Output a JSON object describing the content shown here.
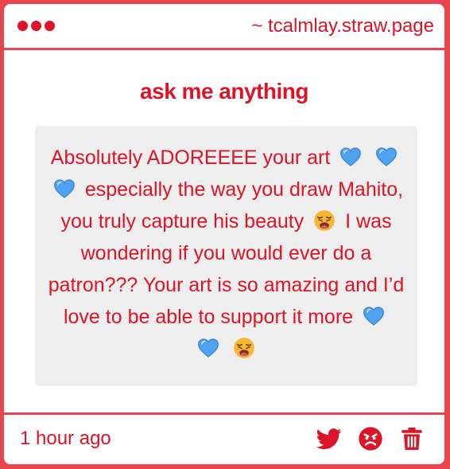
{
  "window": {
    "url": "~ tcalmlay.straw.page"
  },
  "card": {
    "heading": "ask me anything",
    "question": {
      "seg1": "Absolutely ADOREEEE your art",
      "seg2": "especially the way you draw Mahito, you truly capture his beauty",
      "seg3": "I was wondering if you would ever do a patron??? Your art is so amazing and I’d love to be able to support it more"
    },
    "timestamp": "1 hour ago"
  },
  "icons": {
    "window_dots": "traffic-light-dots",
    "heart": "blue-heart-emoji",
    "weary": "weary-face-emoji",
    "share": "twitter-bird-icon",
    "block": "angry-face-icon",
    "delete": "trash-icon"
  },
  "colors": {
    "accent": "#dc1428",
    "border": "#e8454f",
    "question_bg": "#eeeeee",
    "heart": "#4fa3ef"
  }
}
